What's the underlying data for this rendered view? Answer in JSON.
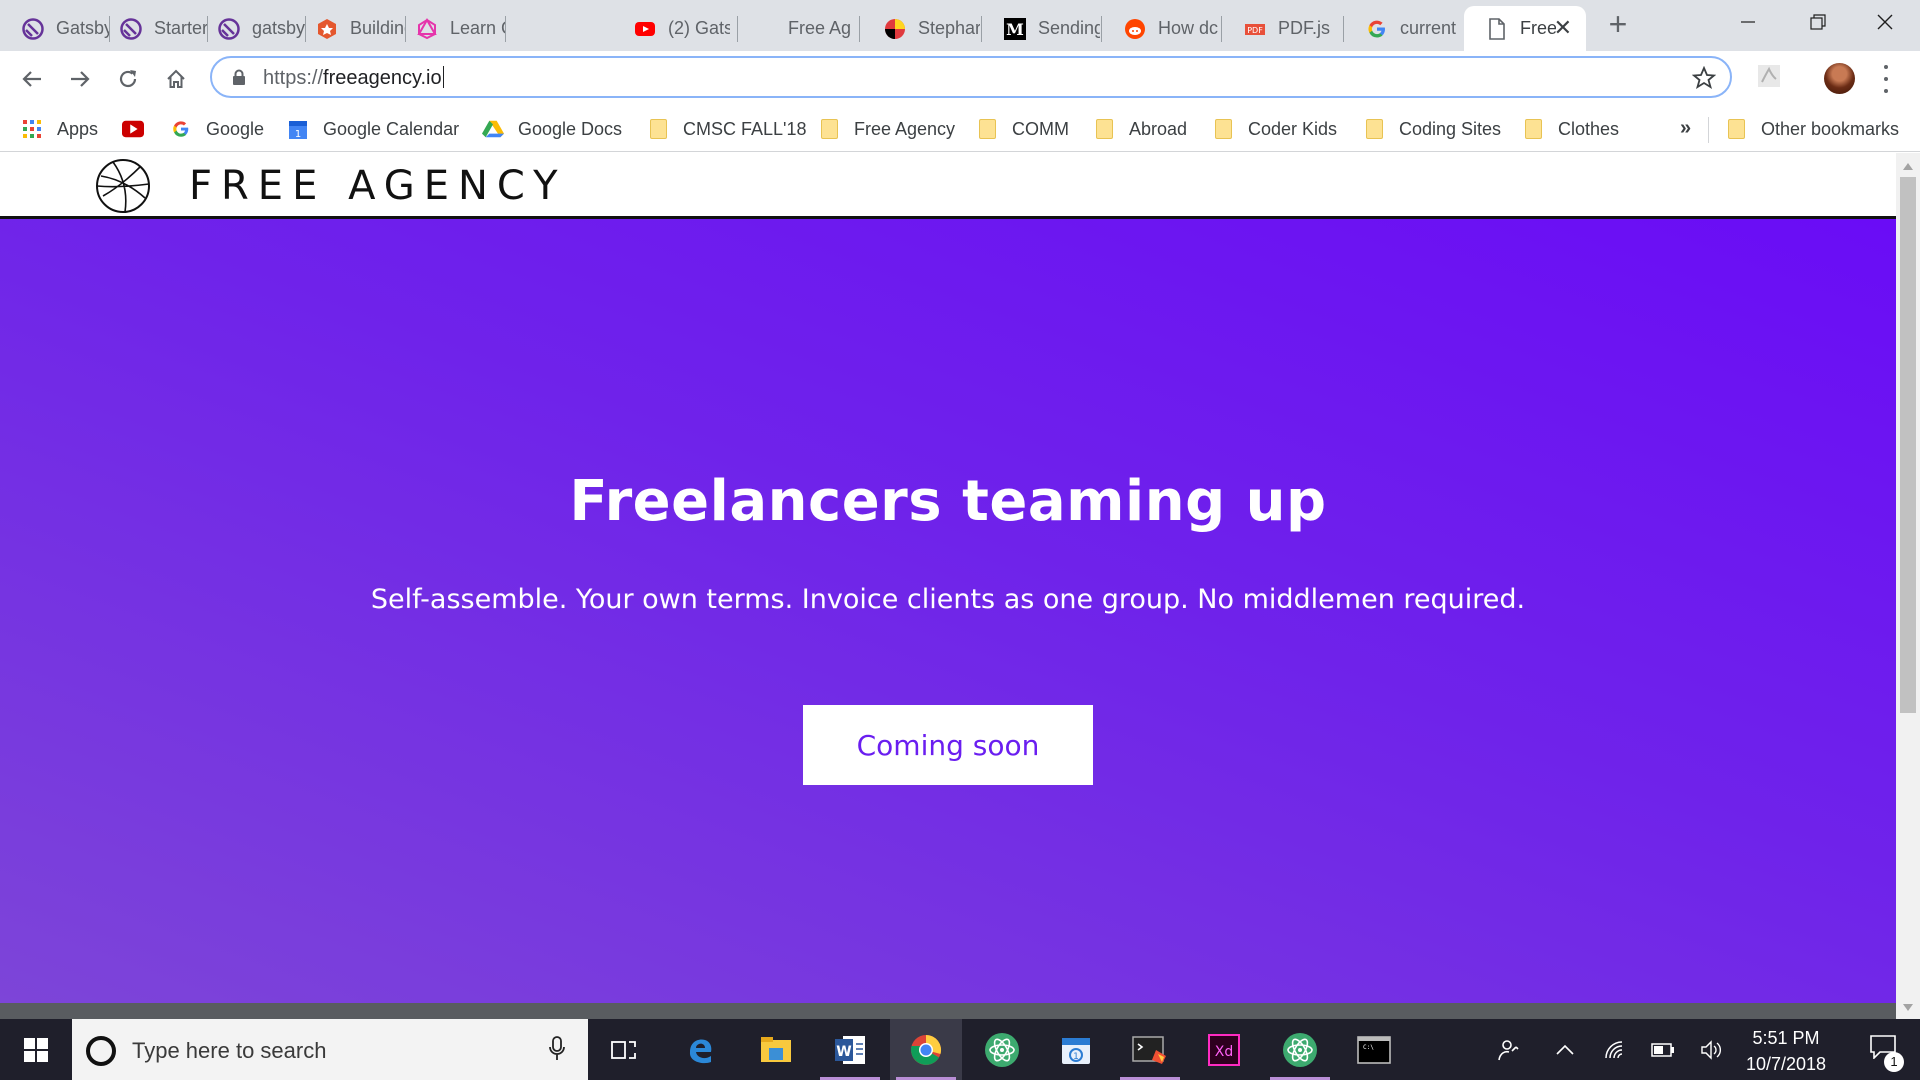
{
  "browser": {
    "tabs": [
      {
        "title": "Gatsby",
        "icon": "gatsby-icon"
      },
      {
        "title": "Starter",
        "icon": "gatsby-icon"
      },
      {
        "title": "gatsby-",
        "icon": "gatsby-icon"
      },
      {
        "title": "Building",
        "icon": "badge-icon"
      },
      {
        "title": "Learn G",
        "icon": "graphql-icon"
      },
      {
        "title": "(2) Gats",
        "icon": "youtube-icon"
      },
      {
        "title": "Free Ag",
        "icon": "blank-icon"
      },
      {
        "title": "Stephar",
        "icon": "maryland-icon"
      },
      {
        "title": "Sending",
        "icon": "medium-icon"
      },
      {
        "title": "How dc",
        "icon": "reddit-icon"
      },
      {
        "title": "PDF.js",
        "icon": "pdf-icon"
      },
      {
        "title": "current",
        "icon": "google-icon"
      },
      {
        "title": "Free",
        "icon": "page-icon",
        "active": true
      }
    ],
    "url_scheme": "https://",
    "url_host": "freeagency.io",
    "bookmarks": [
      {
        "label": "Apps",
        "icon": "apps-grid-icon"
      },
      {
        "label": "",
        "icon": "youtube-icon"
      },
      {
        "label": "Google",
        "icon": "google-icon"
      },
      {
        "label": "Google Calendar",
        "icon": "calendar-icon"
      },
      {
        "label": "Google Docs",
        "icon": "drive-icon"
      },
      {
        "label": "CMSC FALL'18",
        "icon": "folder-icon"
      },
      {
        "label": "Free Agency",
        "icon": "folder-icon"
      },
      {
        "label": "COMM",
        "icon": "folder-icon"
      },
      {
        "label": "Abroad",
        "icon": "folder-icon"
      },
      {
        "label": "Coder Kids",
        "icon": "folder-icon"
      },
      {
        "label": "Coding Sites",
        "icon": "folder-icon"
      },
      {
        "label": "Clothes",
        "icon": "folder-icon"
      }
    ],
    "bookmarks_overflow": "»",
    "other_bookmarks": "Other bookmarks"
  },
  "site": {
    "name": "FREE AGENCY",
    "hero_title": "Freelancers teaming up",
    "hero_subtitle": "Self-assemble. Your own terms. Invoice clients as one group. No middlemen required.",
    "cta_label": "Coming soon",
    "colors": {
      "hero_top": "#6a0cf6",
      "hero_bottom": "#7d45d8",
      "cta_text": "#6a1ef0"
    }
  },
  "taskbar": {
    "search_placeholder": "Type here to search",
    "time": "5:51 PM",
    "date": "10/7/2018",
    "notification_count": "1",
    "apps": [
      "task-view-icon",
      "edge-icon",
      "file-explorer-icon",
      "word-icon",
      "chrome-icon",
      "atom-icon",
      "calendar-app-icon",
      "git-bash-icon",
      "adobe-xd-icon",
      "atom-icon",
      "terminal-icon"
    ]
  }
}
